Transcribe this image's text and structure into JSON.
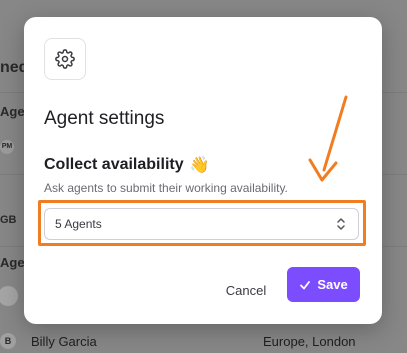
{
  "background": {
    "heading_fragment": "ned",
    "col_fragment_1": "Age",
    "avatar_pm": "PM",
    "gb_fragment": "GB",
    "col_fragment_2": "Age",
    "row_initial": "B",
    "row_name": "Billy Garcia",
    "row_location": "Europe, London"
  },
  "modal": {
    "icon": "gear-icon",
    "title": "Agent settings",
    "section_title": "Collect availability",
    "section_emoji": "👋",
    "hint": "Ask agents to submit their working availability.",
    "select_value": "5 Agents",
    "cancel_label": "Cancel",
    "save_label": "Save"
  },
  "colors": {
    "accent": "#7c4dff",
    "annotation": "#f07d22"
  }
}
